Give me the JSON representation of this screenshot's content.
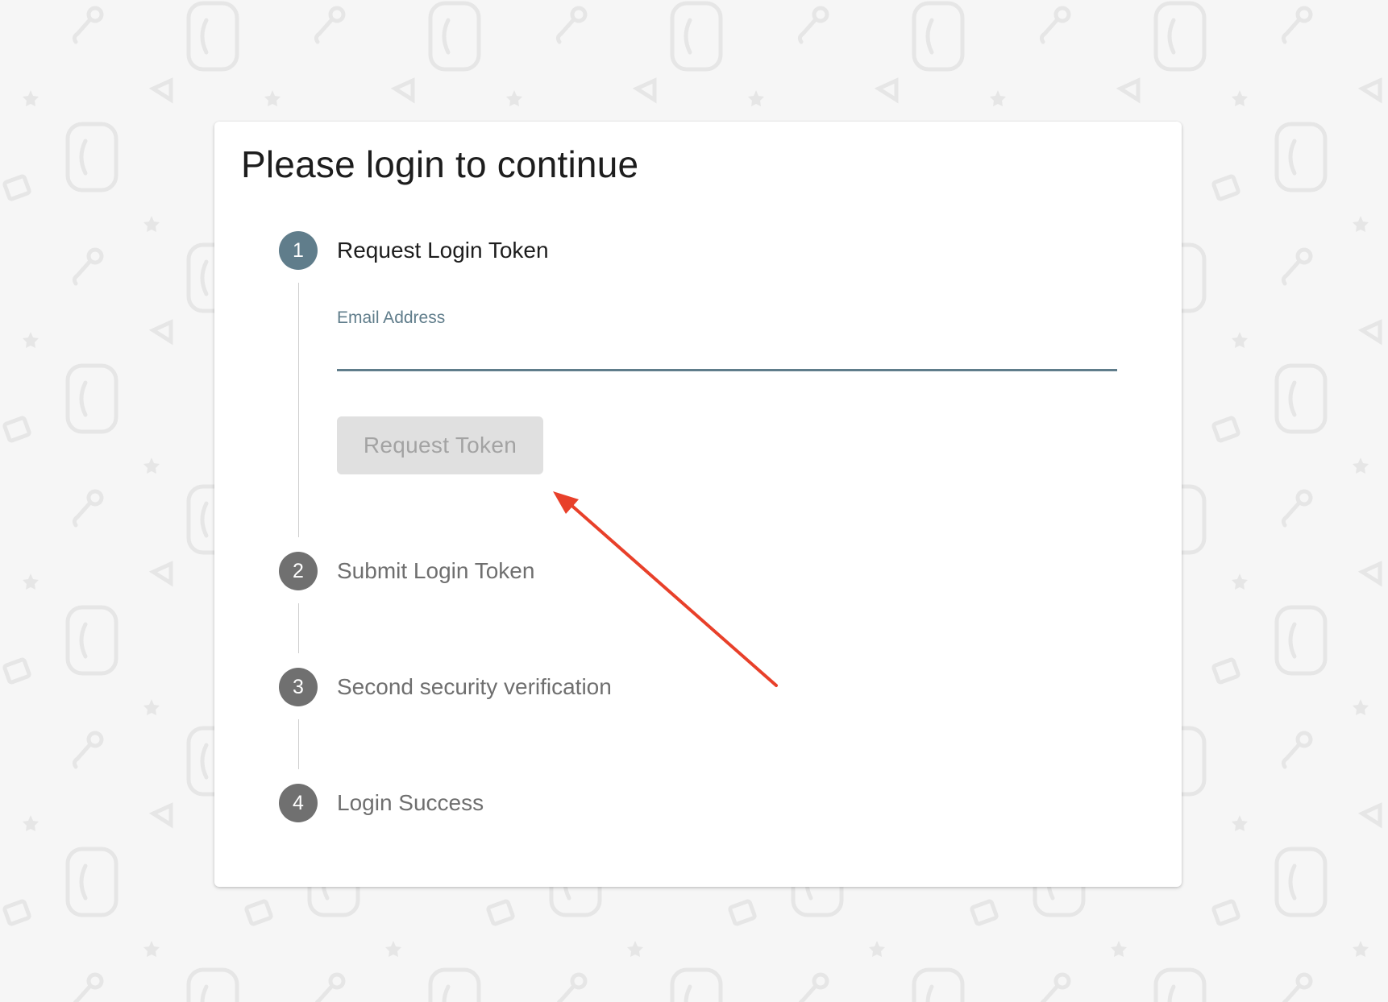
{
  "page": {
    "title": "Please login to continue"
  },
  "steps": [
    {
      "number": "1",
      "label": "Request Login Token",
      "state": "active"
    },
    {
      "number": "2",
      "label": "Submit Login Token",
      "state": "inactive"
    },
    {
      "number": "3",
      "label": "Second security verification",
      "state": "inactive"
    },
    {
      "number": "4",
      "label": "Login Success",
      "state": "inactive"
    }
  ],
  "email_field": {
    "label": "Email Address",
    "value": ""
  },
  "request_button": {
    "label": "Request Token",
    "disabled": true
  },
  "colors": {
    "accent": "#607d8b",
    "inactive_step": "#707070",
    "annotation_arrow": "#e8402a",
    "page_background": "#f6f6f6"
  },
  "background_pattern": {
    "icons": [
      "c3-presents-logo-icon",
      "microphone-icon",
      "megaphone-icon",
      "ticket-icon",
      "star-icon"
    ]
  }
}
